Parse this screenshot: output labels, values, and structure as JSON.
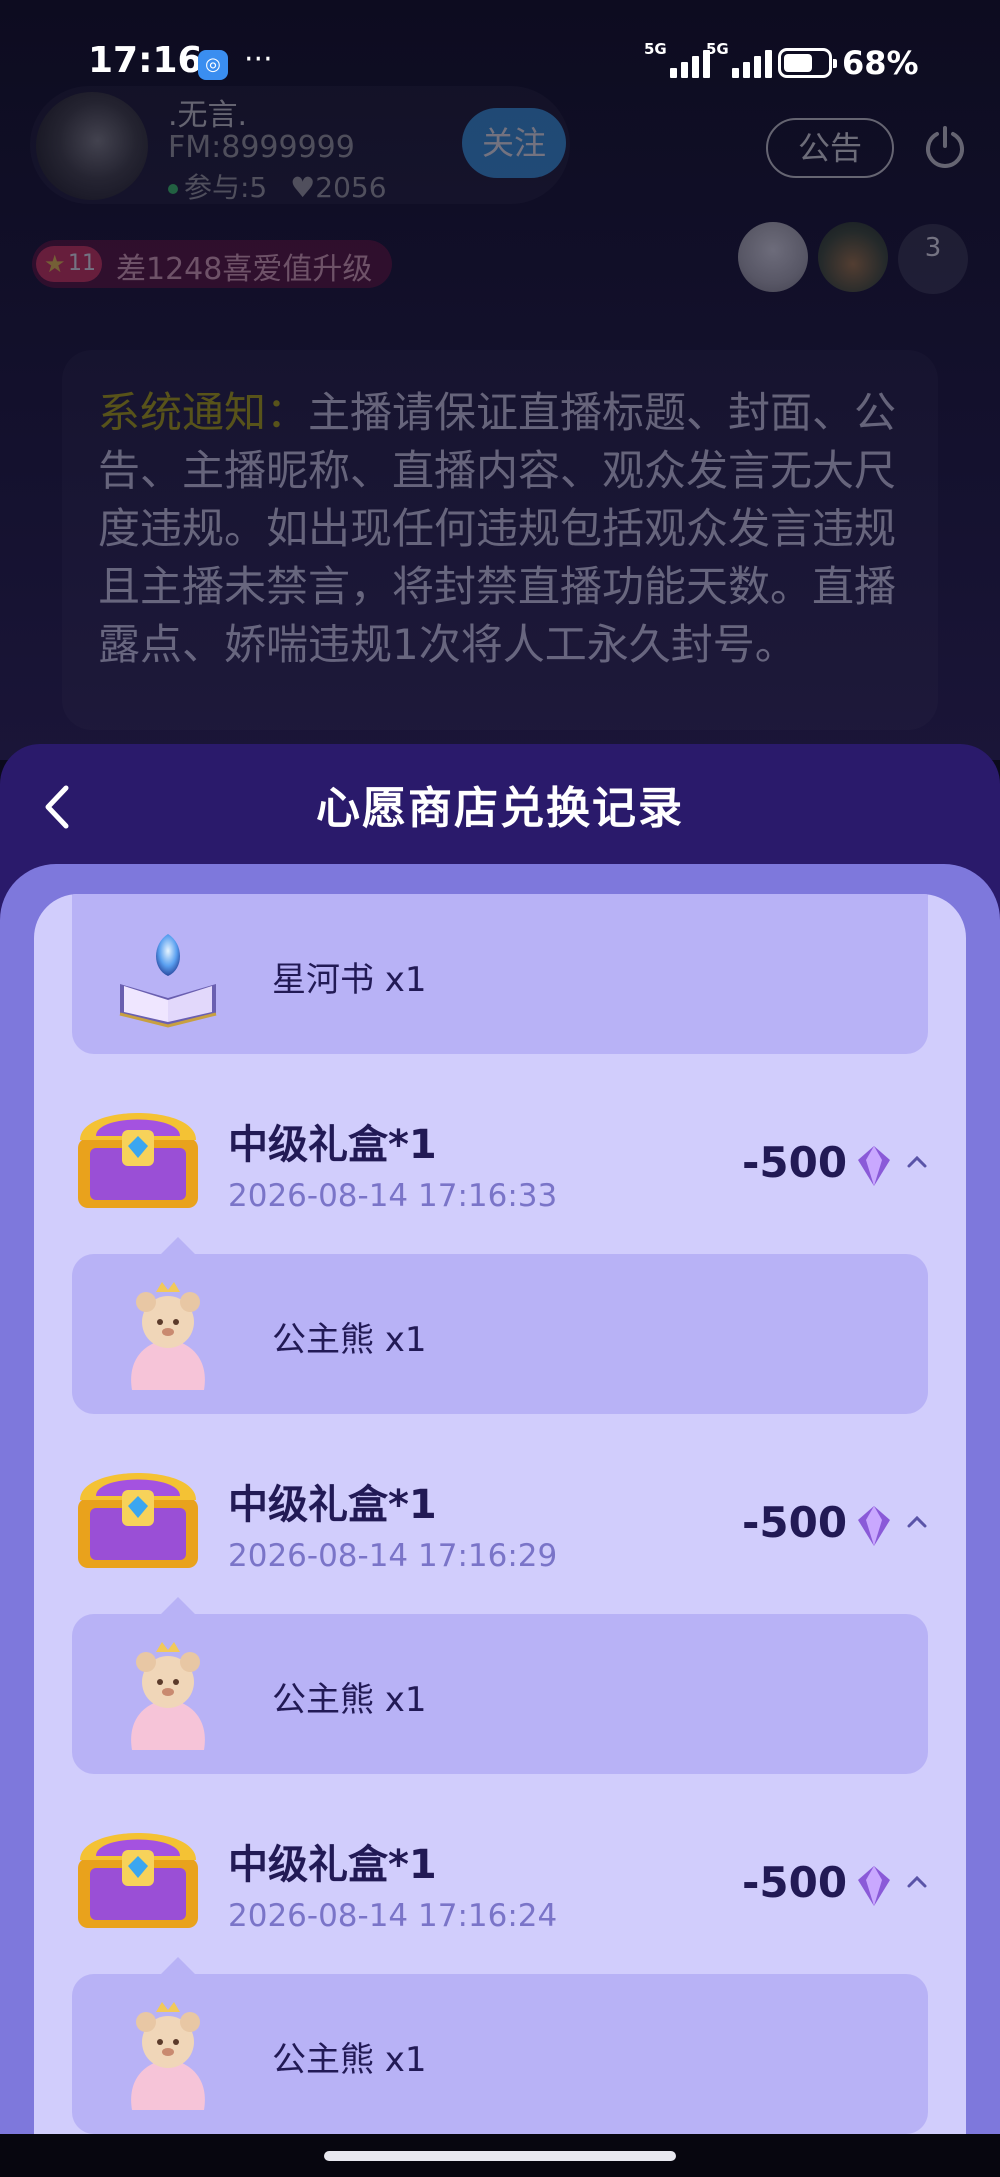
{
  "status_bar": {
    "time": "17:16",
    "more": "···",
    "signal_1": "5G",
    "signal_2": "5G",
    "battery_pct": "68%",
    "battery_level": 0.68
  },
  "room": {
    "host_name": ".无言.",
    "host_fm": "FM:8999999",
    "participants": "参与:5",
    "likes": "♥2056",
    "follow_label": "关注",
    "notice_label": "公告",
    "level_number": "11",
    "level_text": "差1248喜爱值升级",
    "viewer_count": "3",
    "system_notice_label": "系统通知：",
    "system_notice_text": "主播请保证直播标题、封面、公告、主播昵称、直播内容、观众发言无大尺度违规。如出现任何违规包括观众发言违规且主播未禁言，将封禁直播功能天数。直播露点、娇喘违规1次将人工永久封号。"
  },
  "sheet": {
    "title": "心愿商店兑换记录",
    "back_icon": "chevron-left-icon",
    "records": [
      {
        "reward": "星河书 x1"
      },
      {
        "title": "中级礼盒*1",
        "time": "2026-08-14 17:16:33",
        "amount": "-500",
        "reward": "公主熊 x1"
      },
      {
        "title": "中级礼盒*1",
        "time": "2026-08-14 17:16:29",
        "amount": "-500",
        "reward": "公主熊 x1"
      },
      {
        "title": "中级礼盒*1",
        "time": "2026-08-14 17:16:24",
        "amount": "-500",
        "reward": "公主熊 x1"
      }
    ]
  },
  "colors": {
    "sheet_header": "#2a1a6b",
    "list_frame": "#7e78dc",
    "list_panel": "#d1cdfc",
    "reward_card": "#b8b2f6",
    "text_dark": "#221a55",
    "text_time": "#7a74c8"
  }
}
